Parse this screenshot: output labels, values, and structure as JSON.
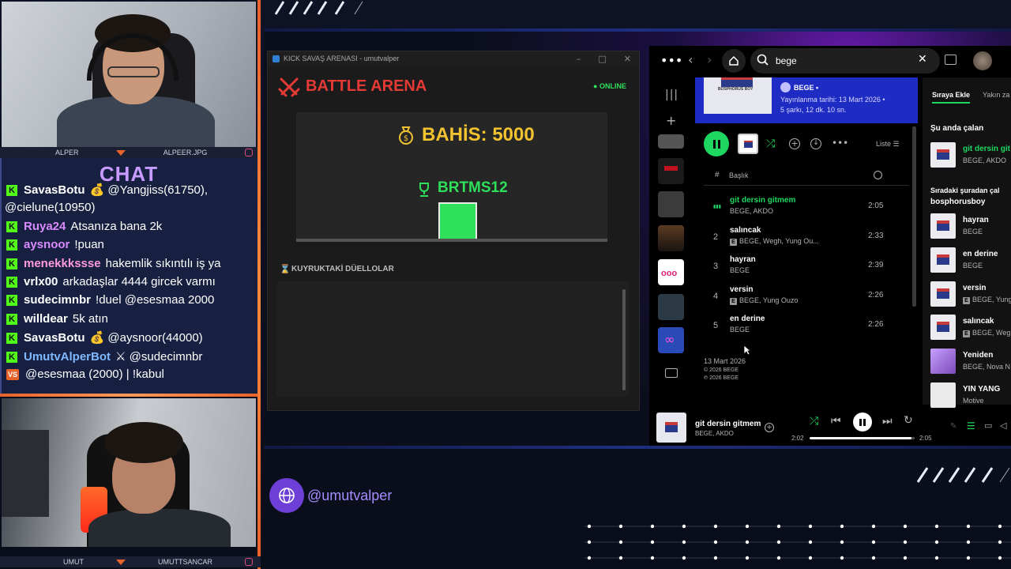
{
  "cams": {
    "top": {
      "left_label": "ALPER",
      "right_label": "ALPEER.JPG"
    },
    "bottom": {
      "left_label": "UMUT",
      "right_label": "UMUTTSANCAR"
    }
  },
  "chat": {
    "title": "CHAT",
    "messages": [
      {
        "badge": "K",
        "user": "SavasBotu",
        "user_color": "#ffffff",
        "text": "💰 @Yangjiss(61750),"
      },
      {
        "badge": "",
        "user": "",
        "user_color": "#ffffff",
        "text": "@cielune(10950)"
      },
      {
        "badge": "K",
        "user": "Ruya24",
        "user_color": "#d98bff",
        "text": "Atsanıza bana 2k"
      },
      {
        "badge": "K",
        "user": "aysnoor",
        "user_color": "#d98bff",
        "text": "!puan"
      },
      {
        "badge": "K",
        "user": "menekkkssse",
        "user_color": "#ff9bd8",
        "text": "hakemlik sıkıntılı iş ya"
      },
      {
        "badge": "K",
        "user": "vrlx00",
        "user_color": "#ffffff",
        "text": "arkadaşlar 4444 gircek varmı"
      },
      {
        "badge": "K",
        "user": "sudecimnbr",
        "user_color": "#ffffff",
        "text": "!duel @esesmaa 2000"
      },
      {
        "badge": "K",
        "user": "willdear",
        "user_color": "#ffffff",
        "text": "5k atın"
      },
      {
        "badge": "K",
        "user": "SavasBotu",
        "user_color": "#ffffff",
        "text": "💰 @aysnoor(44000)"
      },
      {
        "badge": "K",
        "user": "UmutvAlperBot",
        "user_color": "#7fb8ff",
        "text": "⚔ @sudecimnbr"
      },
      {
        "badge": "VS",
        "user": "",
        "user_color": "#ffffff",
        "text": "@esesmaa (2000) | !kabul"
      }
    ]
  },
  "battle": {
    "window_title": "KICK SAVAŞ ARENASI - umutvalper",
    "title": "BATTLE ARENA",
    "status": "ONLINE",
    "bet_label": "BAHİS: 5000",
    "winner": "BRTMS12",
    "queue_label": "KUYRUKTAKİ DÜELLOLAR",
    "colors": {
      "accent_red": "#e53935",
      "gold": "#f2c230",
      "green": "#2ee05a"
    }
  },
  "spotify": {
    "search_value": "bege",
    "album": {
      "artist_line": "BEGE •",
      "release": "Yayınlanma tarihi: 13 Mart 2026 •",
      "summary": "5 şarkı, 12 dk. 10 sn.",
      "cover_text": "BOSPHORUS BOY"
    },
    "list_label": "Liste",
    "col_hash": "#",
    "col_title": "Başlık",
    "tracks": [
      {
        "num": "",
        "title": "git dersin gitmem",
        "artists": "BEGE, AKDO",
        "explicit": false,
        "duration": "2:05",
        "playing": true
      },
      {
        "num": "2",
        "title": "salıncak",
        "artists": "BEGE, Wegh, Yung Ou...",
        "explicit": true,
        "duration": "2:33",
        "playing": false
      },
      {
        "num": "3",
        "title": "hayran",
        "artists": "BEGE",
        "explicit": false,
        "duration": "2:39",
        "playing": false
      },
      {
        "num": "4",
        "title": "versin",
        "artists": "BEGE, Yung Ouzo",
        "explicit": true,
        "duration": "2:26",
        "playing": false
      },
      {
        "num": "5",
        "title": "en derine",
        "artists": "BEGE",
        "explicit": false,
        "duration": "2:26",
        "playing": false
      }
    ],
    "footer_date": "13 Mart 2026",
    "footer_c1": "© 2026 BEGE",
    "footer_c2": "℗ 2026 BEGE",
    "queue": {
      "tab_queue": "Sıraya Ekle",
      "tab_recent": "Yakın za",
      "now_label": "Şu anda çalan",
      "now": {
        "title": "git dersin git",
        "artists": "BEGE, AKDO"
      },
      "next_label_1": "Sıradaki şuradan çal",
      "next_label_2": "bosphorusboy",
      "items": [
        {
          "title": "hayran",
          "artists": "BEGE"
        },
        {
          "title": "en derine",
          "artists": "BEGE"
        },
        {
          "title": "versin",
          "artists": "BEGE, Yung"
        },
        {
          "title": "salıncak",
          "artists": "BEGE, Weg"
        },
        {
          "title": "Yeniden",
          "artists": "BEGE, Nova N"
        },
        {
          "title": "YIN YANG",
          "artists": "Motive"
        }
      ]
    },
    "player": {
      "title": "git dersin gitmem",
      "artists": "BEGE, AKDO",
      "elapsed": "2:02",
      "total": "2:05",
      "progress": 0.97
    },
    "colors": {
      "green": "#1ed760",
      "header_blue": "#1f2cc4"
    }
  },
  "social": {
    "handle": "@umutvalper"
  }
}
